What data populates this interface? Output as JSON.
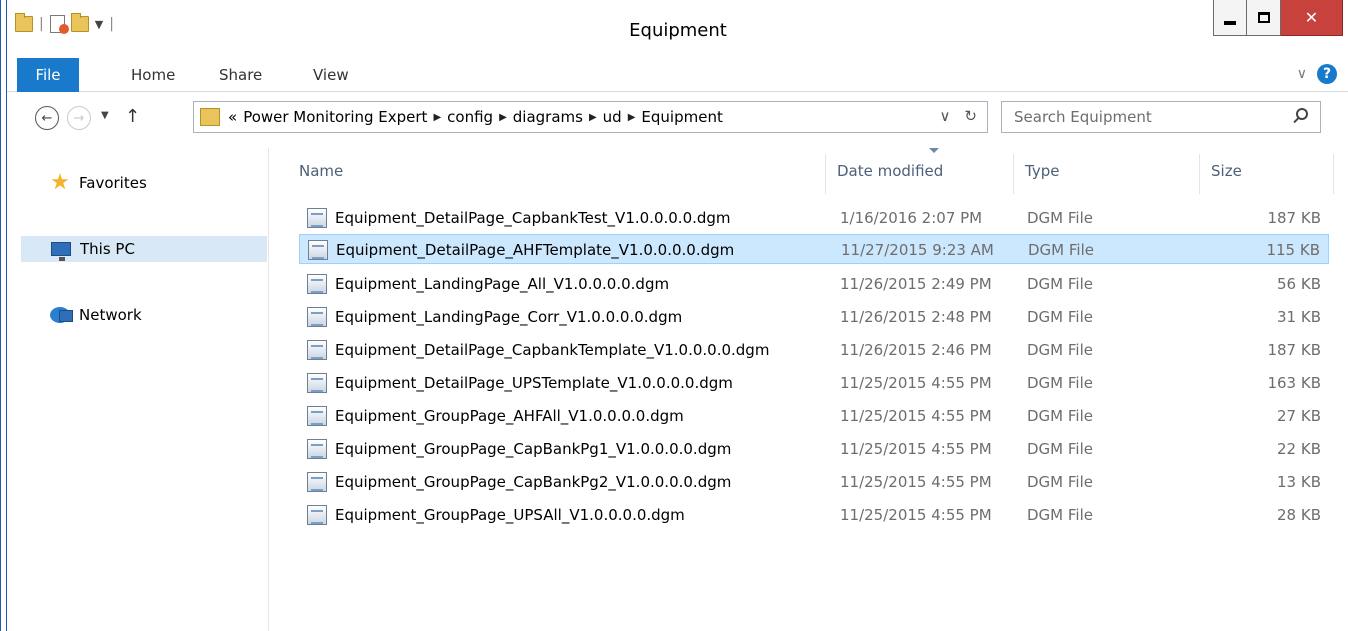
{
  "window": {
    "title": "Equipment"
  },
  "ribbon": {
    "tabs": [
      {
        "label": "File"
      },
      {
        "label": "Home"
      },
      {
        "label": "Share"
      },
      {
        "label": "View"
      }
    ]
  },
  "address": {
    "overflow": "«",
    "crumbs": [
      "Power Monitoring Expert",
      "config",
      "diagrams",
      "ud",
      "Equipment"
    ]
  },
  "search": {
    "placeholder": "Search Equipment"
  },
  "nav_pane": {
    "items": [
      {
        "label": "Favorites",
        "icon": "star-icon"
      },
      {
        "label": "This PC",
        "icon": "computer-icon",
        "selected": true
      },
      {
        "label": "Network",
        "icon": "network-icon"
      }
    ]
  },
  "columns": {
    "name": "Name",
    "date": "Date modified",
    "type": "Type",
    "size": "Size"
  },
  "files": [
    {
      "name": "Equipment_DetailPage_CapbankTest_V1.0.0.0.0.dgm",
      "date": "1/16/2016 2:07 PM",
      "type": "DGM File",
      "size": "187 KB"
    },
    {
      "name": "Equipment_DetailPage_AHFTemplate_V1.0.0.0.0.dgm",
      "date": "11/27/2015 9:23 AM",
      "type": "DGM File",
      "size": "115 KB",
      "selected": true
    },
    {
      "name": "Equipment_LandingPage_All_V1.0.0.0.0.dgm",
      "date": "11/26/2015 2:49 PM",
      "type": "DGM File",
      "size": "56 KB"
    },
    {
      "name": "Equipment_LandingPage_Corr_V1.0.0.0.0.dgm",
      "date": "11/26/2015 2:48 PM",
      "type": "DGM File",
      "size": "31 KB"
    },
    {
      "name": "Equipment_DetailPage_CapbankTemplate_V1.0.0.0.0.dgm",
      "date": "11/26/2015 2:46 PM",
      "type": "DGM File",
      "size": "187 KB"
    },
    {
      "name": "Equipment_DetailPage_UPSTemplate_V1.0.0.0.0.dgm",
      "date": "11/25/2015 4:55 PM",
      "type": "DGM File",
      "size": "163 KB"
    },
    {
      "name": "Equipment_GroupPage_AHFAll_V1.0.0.0.0.dgm",
      "date": "11/25/2015 4:55 PM",
      "type": "DGM File",
      "size": "27 KB"
    },
    {
      "name": "Equipment_GroupPage_CapBankPg1_V1.0.0.0.0.dgm",
      "date": "11/25/2015 4:55 PM",
      "type": "DGM File",
      "size": "22 KB"
    },
    {
      "name": "Equipment_GroupPage_CapBankPg2_V1.0.0.0.0.dgm",
      "date": "11/25/2015 4:55 PM",
      "type": "DGM File",
      "size": "13 KB"
    },
    {
      "name": "Equipment_GroupPage_UPSAll_V1.0.0.0.0.dgm",
      "date": "11/25/2015 4:55 PM",
      "type": "DGM File",
      "size": "28 KB"
    }
  ],
  "colors": {
    "accent": "#1979ca",
    "selection": "#cce8ff",
    "close": "#c8423d"
  }
}
